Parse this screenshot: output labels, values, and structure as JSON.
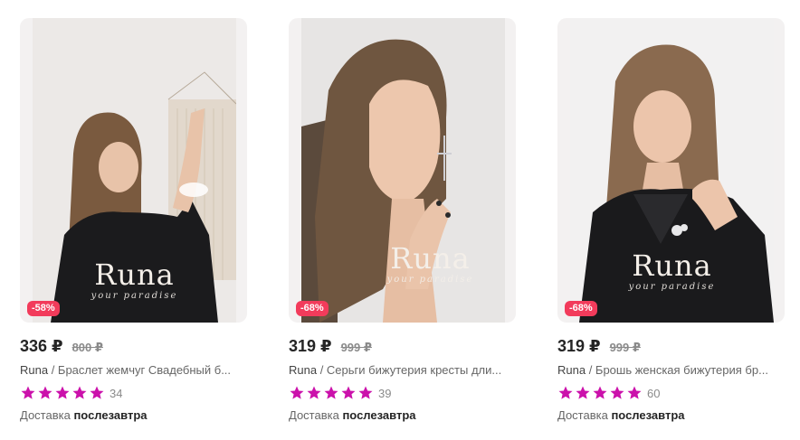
{
  "products": [
    {
      "logo": "Runa",
      "logo_sub": "your paradise",
      "discount": "-58%",
      "price": "336 ₽",
      "old_price": "800 ₽",
      "brand": "Runa",
      "separator": " / ",
      "name": "Браслет жемчуг Свадебный б...",
      "reviews": "34",
      "delivery_label": "Доставка",
      "delivery_value": "послезавтра",
      "rating": 5
    },
    {
      "logo": "Runa",
      "logo_sub": "your paradise",
      "discount": "-68%",
      "price": "319 ₽",
      "old_price": "999 ₽",
      "brand": "Runa",
      "separator": " / ",
      "name": "Серьги бижутерия кресты дли...",
      "reviews": "39",
      "delivery_label": "Доставка",
      "delivery_value": "послезавтра",
      "rating": 5
    },
    {
      "logo": "Runa",
      "logo_sub": "your paradise",
      "discount": "-68%",
      "price": "319 ₽",
      "old_price": "999 ₽",
      "brand": "Runa",
      "separator": " / ",
      "name": "Брошь женская бижутерия бр...",
      "reviews": "60",
      "delivery_label": "Доставка",
      "delivery_value": "послезавтра",
      "rating": 5
    }
  ],
  "colors": {
    "star": "#cb11ab",
    "badge": "#f23b5b",
    "price": "#242424"
  },
  "icons": {
    "rating_star": "star-icon"
  }
}
